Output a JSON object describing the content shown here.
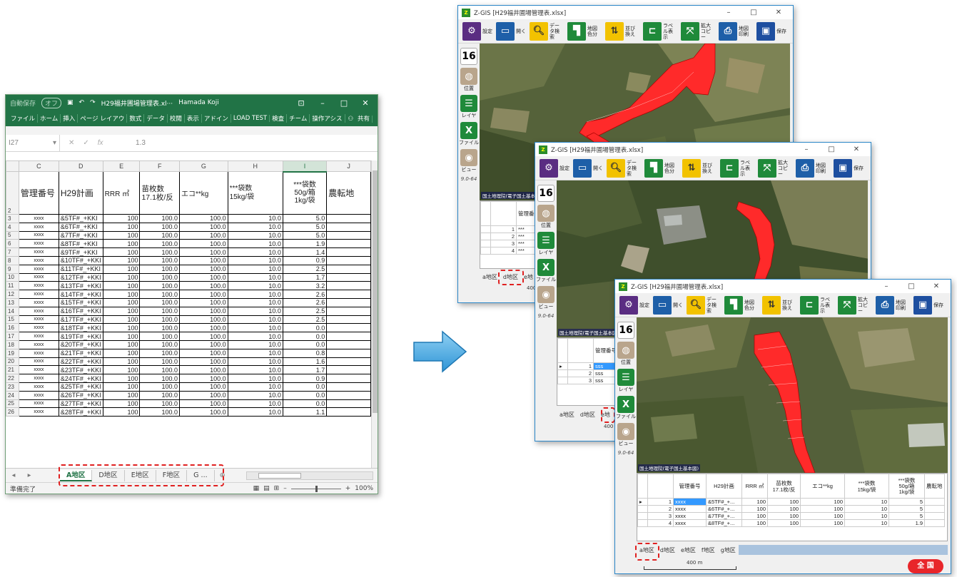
{
  "excel": {
    "autosave_label": "自動保存",
    "autosave_state": "オフ",
    "title": "H29福井圃場管理表.xl···",
    "user": "Hamada Koji",
    "ribbon_tabs": [
      "ファイル",
      "ホーム",
      "挿入",
      "ページ レイアウ",
      "数式",
      "データ",
      "校閲",
      "表示",
      "アドイン",
      "LOAD TEST",
      "検査",
      "チーム",
      "操作アシス"
    ],
    "share_label": "共有",
    "name_box": "I27",
    "formula_value": "1.3",
    "columns": [
      "C",
      "D",
      "E",
      "F",
      "G",
      "H",
      "I",
      "J"
    ],
    "header_row_num": "2",
    "headers": [
      "管理番号",
      "H29計画",
      "RRR ㎡",
      "苗枚数\n17.1枚/反",
      "エコ**kg",
      "***袋数\n15kg/袋",
      "***袋数\n50g/箱\n1kg/袋",
      "農転地"
    ],
    "rows": [
      [
        "3",
        "xxxx",
        "&5TF#_+KKI",
        "100",
        "100.0",
        "100.0",
        "10.0",
        "5.0"
      ],
      [
        "4",
        "xxxx",
        "&6TF#_+KKI",
        "100",
        "100.0",
        "100.0",
        "10.0",
        "5.0"
      ],
      [
        "5",
        "xxxx",
        "&7TF#_+KKI",
        "100",
        "100.0",
        "100.0",
        "10.0",
        "5.0"
      ],
      [
        "6",
        "xxxx",
        "&8TF#_+KKI",
        "100",
        "100.0",
        "100.0",
        "10.0",
        "1.9"
      ],
      [
        "7",
        "xxxx",
        "&9TF#_+KKI",
        "100",
        "100.0",
        "100.0",
        "10.0",
        "1.4"
      ],
      [
        "8",
        "xxxx",
        "&10TF#_+KKI",
        "100",
        "100.0",
        "100.0",
        "10.0",
        "0.9"
      ],
      [
        "9",
        "xxxx",
        "&11TF#_+KKI",
        "100",
        "100.0",
        "100.0",
        "10.0",
        "2.5"
      ],
      [
        "10",
        "xxxx",
        "&12TF#_+KKI",
        "100",
        "100.0",
        "100.0",
        "10.0",
        "1.7"
      ],
      [
        "11",
        "xxxx",
        "&13TF#_+KKI",
        "100",
        "100.0",
        "100.0",
        "10.0",
        "3.2"
      ],
      [
        "12",
        "xxxx",
        "&14TF#_+KKI",
        "100",
        "100.0",
        "100.0",
        "10.0",
        "2.6"
      ],
      [
        "13",
        "xxxx",
        "&15TF#_+KKI",
        "100",
        "100.0",
        "100.0",
        "10.0",
        "2.6"
      ],
      [
        "14",
        "xxxx",
        "&16TF#_+KKI",
        "100",
        "100.0",
        "100.0",
        "10.0",
        "2.5"
      ],
      [
        "15",
        "xxxx",
        "&17TF#_+KKI",
        "100",
        "100.0",
        "100.0",
        "10.0",
        "2.5"
      ],
      [
        "16",
        "xxxx",
        "&18TF#_+KKI",
        "100",
        "100.0",
        "100.0",
        "10.0",
        "0.0"
      ],
      [
        "17",
        "xxxx",
        "&19TF#_+KKI",
        "100",
        "100.0",
        "100.0",
        "10.0",
        "0.0"
      ],
      [
        "18",
        "xxxx",
        "&20TF#_+KKI",
        "100",
        "100.0",
        "100.0",
        "10.0",
        "0.0"
      ],
      [
        "19",
        "xxxx",
        "&21TF#_+KKI",
        "100",
        "100.0",
        "100.0",
        "10.0",
        "0.8"
      ],
      [
        "20",
        "xxxx",
        "&22TF#_+KKI",
        "100",
        "100.0",
        "100.0",
        "10.0",
        "1.6"
      ],
      [
        "21",
        "xxxx",
        "&23TF#_+KKI",
        "100",
        "100.0",
        "100.0",
        "10.0",
        "1.7"
      ],
      [
        "22",
        "xxxx",
        "&24TF#_+KKI",
        "100",
        "100.0",
        "100.0",
        "10.0",
        "0.9"
      ],
      [
        "23",
        "xxxx",
        "&25TF#_+KKI",
        "100",
        "100.0",
        "100.0",
        "10.0",
        "0.0"
      ],
      [
        "24",
        "xxxx",
        "&26TF#_+KKI",
        "100",
        "100.0",
        "100.0",
        "10.0",
        "0.0"
      ],
      [
        "25",
        "xxxx",
        "&27TF#_+KKI",
        "100",
        "100.0",
        "100.0",
        "10.0",
        "0.0"
      ],
      [
        "26",
        "xxxx",
        "&28TF#_+KKI",
        "100",
        "100.0",
        "100.0",
        "10.0",
        "1.1"
      ]
    ],
    "sheet_tabs": [
      "A地区",
      "D地区",
      "E地区",
      "F地区",
      "G ..."
    ],
    "active_sheet": "A地区",
    "status": "準備完了",
    "zoom": "100%"
  },
  "gis": {
    "title": "Z-GIS [H29福井圃場管理表.xlsx]",
    "toolbar": [
      "設定",
      "開く",
      "データ検索",
      "地図色分",
      "並び換え",
      "ラベル表示",
      "拡大コピー",
      "地図印刷",
      "保存"
    ],
    "side": [
      "位置",
      "レイヤ",
      "ファイル",
      "ビュー"
    ],
    "zoom_level": "16",
    "version": "9.0-64",
    "attribution": "国土地理院(電子国土基本図)",
    "grid_headers": [
      "管理番号",
      "H29計画",
      "RRR ㎡",
      "苗枚数\n17.1枚/反",
      "エコ**kg",
      "***袋数\n15kg/袋",
      "***袋数\n50g/箱\n1kg/袋",
      "農転地"
    ],
    "grid_rows": [
      [
        "1",
        "xxxx",
        "&5TF#_+...",
        "100",
        "100",
        "100",
        "10",
        "5"
      ],
      [
        "2",
        "xxxx",
        "&6TF#_+...",
        "100",
        "100",
        "100",
        "10",
        "5"
      ],
      [
        "3",
        "xxxx",
        "&7TF#_+...",
        "100",
        "100",
        "100",
        "10",
        "5"
      ],
      [
        "4",
        "xxxx",
        "&8TF#_+...",
        "100",
        "100",
        "100",
        "10",
        "1.9"
      ]
    ],
    "w1_rows": [
      [
        "1",
        "***"
      ],
      [
        "2",
        "***"
      ],
      [
        "3",
        "***"
      ],
      [
        "4",
        "***"
      ]
    ],
    "w2_rows": [
      [
        "1",
        "sss"
      ],
      [
        "2",
        "sss"
      ],
      [
        "3",
        "sss"
      ]
    ],
    "tabs": [
      "a地区",
      "d地区",
      "e地区",
      "f地区",
      "g地区"
    ],
    "tabs_w1": [
      "a地区",
      "d地区",
      "e地"
    ],
    "tabs_w2": [
      "a地区",
      "d地区",
      "e地"
    ],
    "scale": "400 m",
    "scale_short": "400",
    "zenkoku": "全 国"
  },
  "colors": {
    "excel_green": "#217346",
    "field_red": "#ff2a2a",
    "highlight_dash": "#e02020",
    "arrow_blue": "#3fa8e4"
  }
}
